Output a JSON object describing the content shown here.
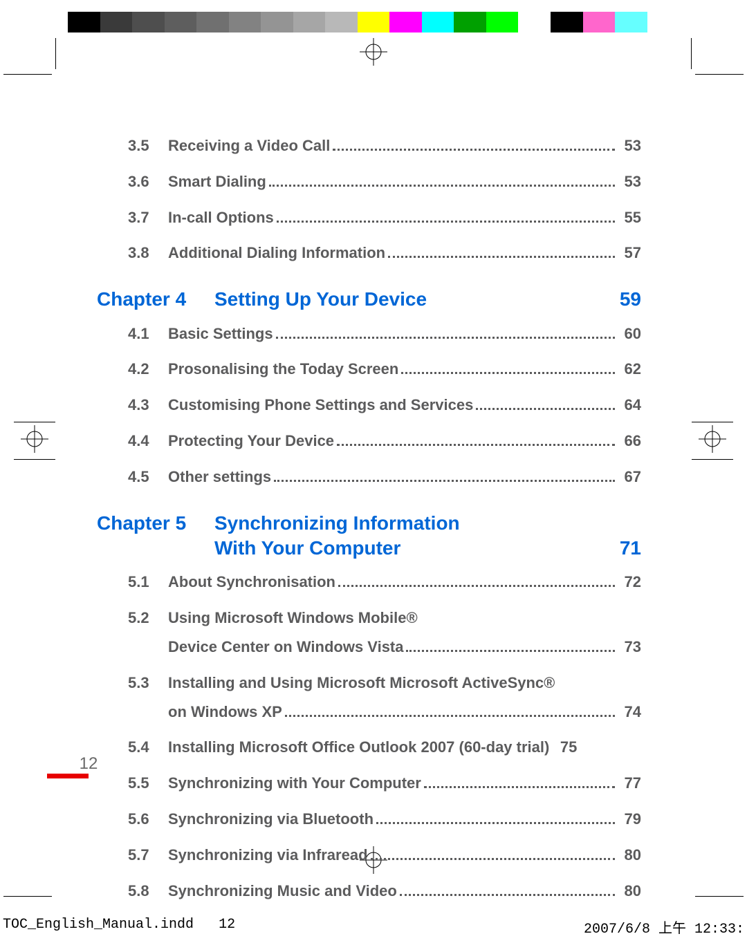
{
  "colorbar_colors": [
    "#000000",
    "#3a3a3a",
    "#4e4e4e",
    "#5e5e5e",
    "#707070",
    "#828282",
    "#949494",
    "#a6a6a6",
    "#b8b8b8",
    "#ffff00",
    "#ff00ff",
    "#00ffff",
    "#00a000",
    "#00ff00",
    "#ffffff",
    "#000000",
    "#ff66cc",
    "#66ffff",
    "#ffffff"
  ],
  "toc": {
    "pre": [
      {
        "num": "3.5",
        "title": "Receiving a Video Call",
        "page": "53"
      },
      {
        "num": "3.6",
        "title": "Smart Dialing",
        "page": "53"
      },
      {
        "num": "3.7",
        "title": "In-call Options",
        "page": "55"
      },
      {
        "num": "3.8",
        "title": "Additional Dialing Information",
        "page": "57"
      }
    ],
    "ch4": {
      "label": "Chapter 4",
      "title": "Setting Up Your Device",
      "page": "59"
    },
    "ch4_items": [
      {
        "num": "4.1",
        "title": "Basic Settings",
        "page": "60"
      },
      {
        "num": "4.2",
        "title": "Prosonalising the Today Screen",
        "page": "62"
      },
      {
        "num": "4.3",
        "title": "Customising Phone Settings and Services",
        "page": "64"
      },
      {
        "num": "4.4",
        "title": "Protecting Your Device",
        "page": "66"
      },
      {
        "num": "4.5",
        "title": "Other settings",
        "page": "67"
      }
    ],
    "ch5": {
      "label": "Chapter 5",
      "title_l1": "Synchronizing Information",
      "title_l2": "With Your Computer",
      "page": "71"
    },
    "ch5_items": [
      {
        "num": "5.1",
        "title": "About Synchronisation",
        "page": "72"
      },
      {
        "num": "5.2",
        "title_l1": "Using Microsoft Windows Mobile®",
        "title_l2": "Device Center on Windows Vista",
        "page": "73",
        "multi": true
      },
      {
        "num": "5.3",
        "title_l1": "Installing and Using Microsoft Microsoft ActiveSync®",
        "title_l2": "on Windows XP",
        "page": "74",
        "multi": true
      },
      {
        "num": "5.4",
        "title": "Installing Microsoft Office Outlook 2007 (60-day trial)",
        "page": "75",
        "tight": true
      },
      {
        "num": "5.5",
        "title": "Synchronizing with Your Computer",
        "page": "77"
      },
      {
        "num": "5.6",
        "title": "Synchronizing via Bluetooth",
        "page": "79"
      },
      {
        "num": "5.7",
        "title": "Synchronizing via Infraread",
        "page": "80"
      },
      {
        "num": "5.8",
        "title": "Synchronizing Music and Video",
        "page": "80"
      }
    ]
  },
  "page_number": "12",
  "slug": {
    "file": "TOC_English_Manual.indd",
    "page": "12",
    "datetime": "2007/6/8   上午 12:33:"
  }
}
